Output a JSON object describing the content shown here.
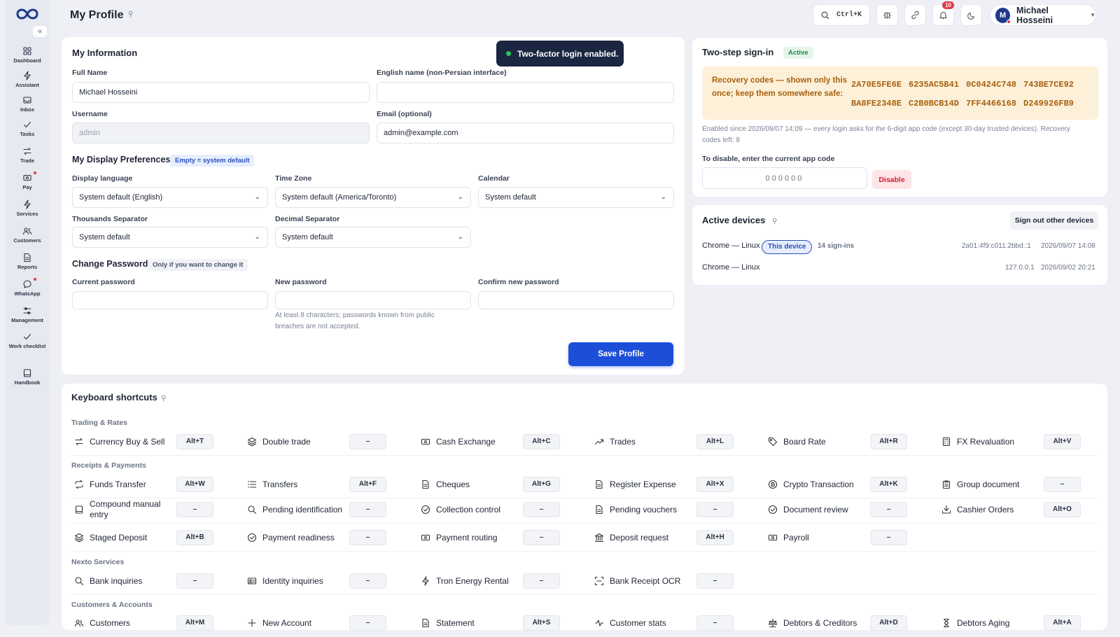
{
  "app": {
    "title": "My Profile"
  },
  "sidebar": {
    "collapse_label": "«",
    "items": [
      {
        "label": "Dashboard",
        "icon": "dashboard-icon"
      },
      {
        "label": "Assistant",
        "icon": "bolt-icon"
      },
      {
        "label": "Inbox",
        "icon": "inbox-icon"
      },
      {
        "label": "Tasks",
        "icon": "check-icon"
      },
      {
        "label": "Trade",
        "icon": "swap-icon"
      },
      {
        "label": "Pay",
        "icon": "wallet-icon"
      },
      {
        "label": "Services",
        "icon": "bolt-icon"
      },
      {
        "label": "Customers",
        "icon": "users-icon"
      },
      {
        "label": "Reports",
        "icon": "document-icon"
      },
      {
        "label": "WhatsApp",
        "icon": "chat-icon"
      },
      {
        "label": "Management",
        "icon": "sliders-icon"
      },
      {
        "label": "Work checklist",
        "icon": "check-icon"
      },
      {
        "label": "Handbook",
        "icon": "book-icon"
      }
    ]
  },
  "topbar": {
    "search_shortcut": "Ctrl+K",
    "notifications_count": "10",
    "user_initial": "M",
    "user_name": "Michael Hosseini"
  },
  "toast": {
    "message": "Two-factor login enabled."
  },
  "my_information": {
    "title": "My Information",
    "full_name_label": "Full Name",
    "full_name_value": "Michael Hosseini",
    "english_name_label": "English name (non-Persian interface)",
    "english_name_value": "",
    "username_label": "Username",
    "username_value": "admin",
    "email_label": "Email (optional)",
    "email_value": "admin@example.com"
  },
  "display_prefs": {
    "title": "My Display Preferences",
    "badge": "Empty = system default",
    "language_label": "Display language",
    "language_value": "System default (English)",
    "timezone_label": "Time Zone",
    "timezone_value": "System default (America/Toronto)",
    "calendar_label": "Calendar",
    "calendar_value": "System default",
    "thousands_label": "Thousands Separator",
    "thousands_value": "System default",
    "decimal_label": "Decimal Separator",
    "decimal_value": "System default"
  },
  "change_password": {
    "title": "Change Password",
    "badge": "Only if you want to change it",
    "current_label": "Current password",
    "new_label": "New password",
    "confirm_label": "Confirm new password",
    "hint_line1": "At least 8 characters; passwords known from public",
    "hint_line2": "breaches are not accepted.",
    "save_label": "Save Profile"
  },
  "two_step": {
    "title": "Two-step sign-in",
    "status": "Active",
    "recovery_label_1": "Recovery codes — shown only this",
    "recovery_label_2": "once; keep them somewhere safe:",
    "codes": [
      "2A70E5FE6E",
      "6235AC5B41",
      "0C0424C748",
      "743BE7CE92",
      "BA8FE2348E",
      "C2B0BCB14D",
      "7FF4466168",
      "D249926FB9"
    ],
    "info_line1": "Enabled since 2026/09/07 14:09 — every login asks for the 6-digit app code (except 30-day trusted devices). Recovery",
    "info_line2": "codes left: 8",
    "disable_label": "To disable, enter the current app code",
    "code_placeholder": "000000",
    "disable_button": "Disable"
  },
  "active_devices": {
    "title": "Active devices",
    "signout_button": "Sign out other devices",
    "devices": [
      {
        "name": "Chrome — Linux",
        "badge": "This device",
        "signins": "14 sign-ins",
        "ip": "2a01:4f9:c011:2bbd::1",
        "time": "2026/09/07 14:08"
      },
      {
        "name": "Chrome — Linux",
        "ip": "127.0.0.1",
        "time": "2026/09/02 20:21"
      }
    ]
  },
  "shortcuts": {
    "title": "Keyboard shortcuts",
    "groups": [
      {
        "label": "Trading & Rates"
      },
      {
        "label": "Receipts & Payments"
      },
      {
        "label": "Nexto Services"
      },
      {
        "label": "Customers & Accounts"
      }
    ],
    "rows": [
      [
        {
          "name": "Currency Buy & Sell",
          "key": "Alt+T",
          "icon": "swap-icon"
        },
        {
          "name": "Double trade",
          "key": "–",
          "icon": "layers-icon"
        },
        {
          "name": "Cash Exchange",
          "key": "Alt+C",
          "icon": "cash-icon"
        },
        {
          "name": "Trades",
          "key": "Alt+L",
          "icon": "trend-icon"
        },
        {
          "name": "Board Rate",
          "key": "Alt+R",
          "icon": "tag-icon"
        },
        {
          "name": "FX Revaluation",
          "key": "Alt+V",
          "icon": "calculator-icon"
        }
      ],
      [
        {
          "name": "Funds Transfer",
          "key": "Alt+W",
          "icon": "repeat-icon"
        },
        {
          "name": "Transfers",
          "key": "Alt+F",
          "icon": "list-icon"
        },
        {
          "name": "Cheques",
          "key": "Alt+G",
          "icon": "document-icon"
        },
        {
          "name": "Register Expense",
          "key": "Alt+X",
          "icon": "document-icon"
        },
        {
          "name": "Crypto Transaction",
          "key": "Alt+K",
          "icon": "coin-icon"
        },
        {
          "name": "Group document",
          "key": "–",
          "icon": "clipboard-icon"
        }
      ],
      [
        {
          "name": "Compound manual entry",
          "key": "–",
          "icon": "book-icon"
        },
        {
          "name": "Pending identification",
          "key": "–",
          "icon": "search-icon"
        },
        {
          "name": "Collection control",
          "key": "–",
          "icon": "check-circle-icon"
        },
        {
          "name": "Pending vouchers",
          "key": "–",
          "icon": "document-icon"
        },
        {
          "name": "Document review",
          "key": "–",
          "icon": "check-circle-icon"
        },
        {
          "name": "Cashier Orders",
          "key": "Alt+O",
          "icon": "download-icon"
        }
      ],
      [
        {
          "name": "Staged Deposit",
          "key": "Alt+B",
          "icon": "layers-icon"
        },
        {
          "name": "Payment readiness",
          "key": "–",
          "icon": "check-circle-icon"
        },
        {
          "name": "Payment routing",
          "key": "–",
          "icon": "cash-icon"
        },
        {
          "name": "Deposit request",
          "key": "Alt+H",
          "icon": "bank-icon"
        },
        {
          "name": "Payroll",
          "key": "–",
          "icon": "cash-icon"
        }
      ],
      [
        {
          "name": "Bank inquiries",
          "key": "–",
          "icon": "search-icon"
        },
        {
          "name": "Identity inquiries",
          "key": "–",
          "icon": "id-card-icon"
        },
        {
          "name": "Tron Energy Rental",
          "key": "–",
          "icon": "bolt-icon"
        },
        {
          "name": "Bank Receipt OCR",
          "key": "–",
          "icon": "scan-icon"
        }
      ],
      [
        {
          "name": "Customers",
          "key": "Alt+M",
          "icon": "users-icon"
        },
        {
          "name": "New Account",
          "key": "–",
          "icon": "plus-icon"
        },
        {
          "name": "Statement",
          "key": "Alt+S",
          "icon": "document-icon"
        },
        {
          "name": "Customer stats",
          "key": "–",
          "icon": "activity-icon"
        },
        {
          "name": "Debtors & Creditors",
          "key": "Alt+D",
          "icon": "scale-icon"
        },
        {
          "name": "Debtors Aging",
          "key": "Alt+A",
          "icon": "hourglass-icon"
        }
      ]
    ]
  }
}
